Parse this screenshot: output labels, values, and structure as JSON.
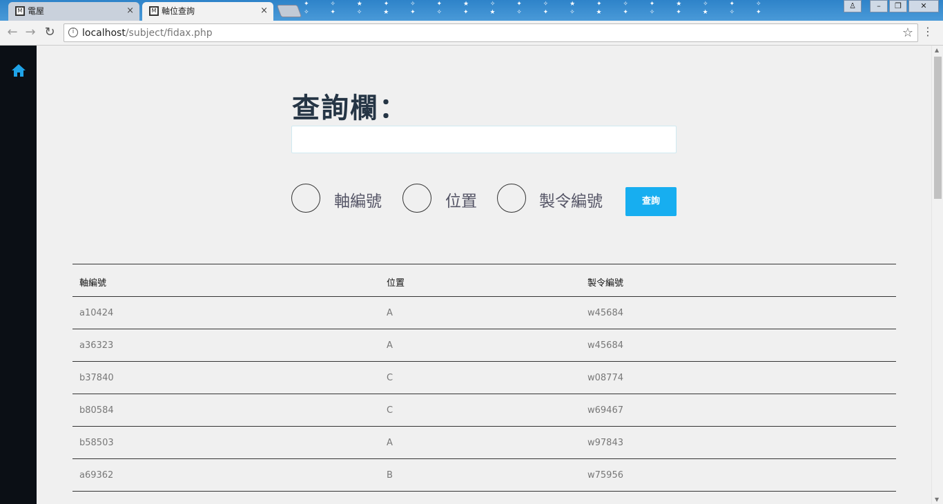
{
  "browser": {
    "tabs": [
      {
        "label": "電屋",
        "close": "×"
      },
      {
        "label": "軸位查詢",
        "close": "×"
      }
    ],
    "url_host": "localhost",
    "url_path": "/subject/fidax.php",
    "window_buttons": {
      "user": "♙",
      "minimize": "–",
      "restore": "❐",
      "close": "✕"
    }
  },
  "sidebar": {
    "home_icon": "home-icon",
    "accent": "#1fa3e8"
  },
  "page": {
    "title": "查詢欄：",
    "search": {
      "value": "",
      "placeholder": ""
    },
    "radios": [
      {
        "label": "軸編號"
      },
      {
        "label": "位置"
      },
      {
        "label": "製令編號"
      }
    ],
    "query_button": "查詢",
    "accent": "#17aef0"
  },
  "table": {
    "headers": [
      "軸編號",
      "位置",
      "製令編號"
    ],
    "rows": [
      [
        "a10424",
        "A",
        "w45684"
      ],
      [
        "a36323",
        "A",
        "w45684"
      ],
      [
        "b37840",
        "C",
        "w08774"
      ],
      [
        "b80584",
        "C",
        "w69467"
      ],
      [
        "b58503",
        "A",
        "w97843"
      ],
      [
        "a69362",
        "B",
        "w75956"
      ]
    ]
  }
}
